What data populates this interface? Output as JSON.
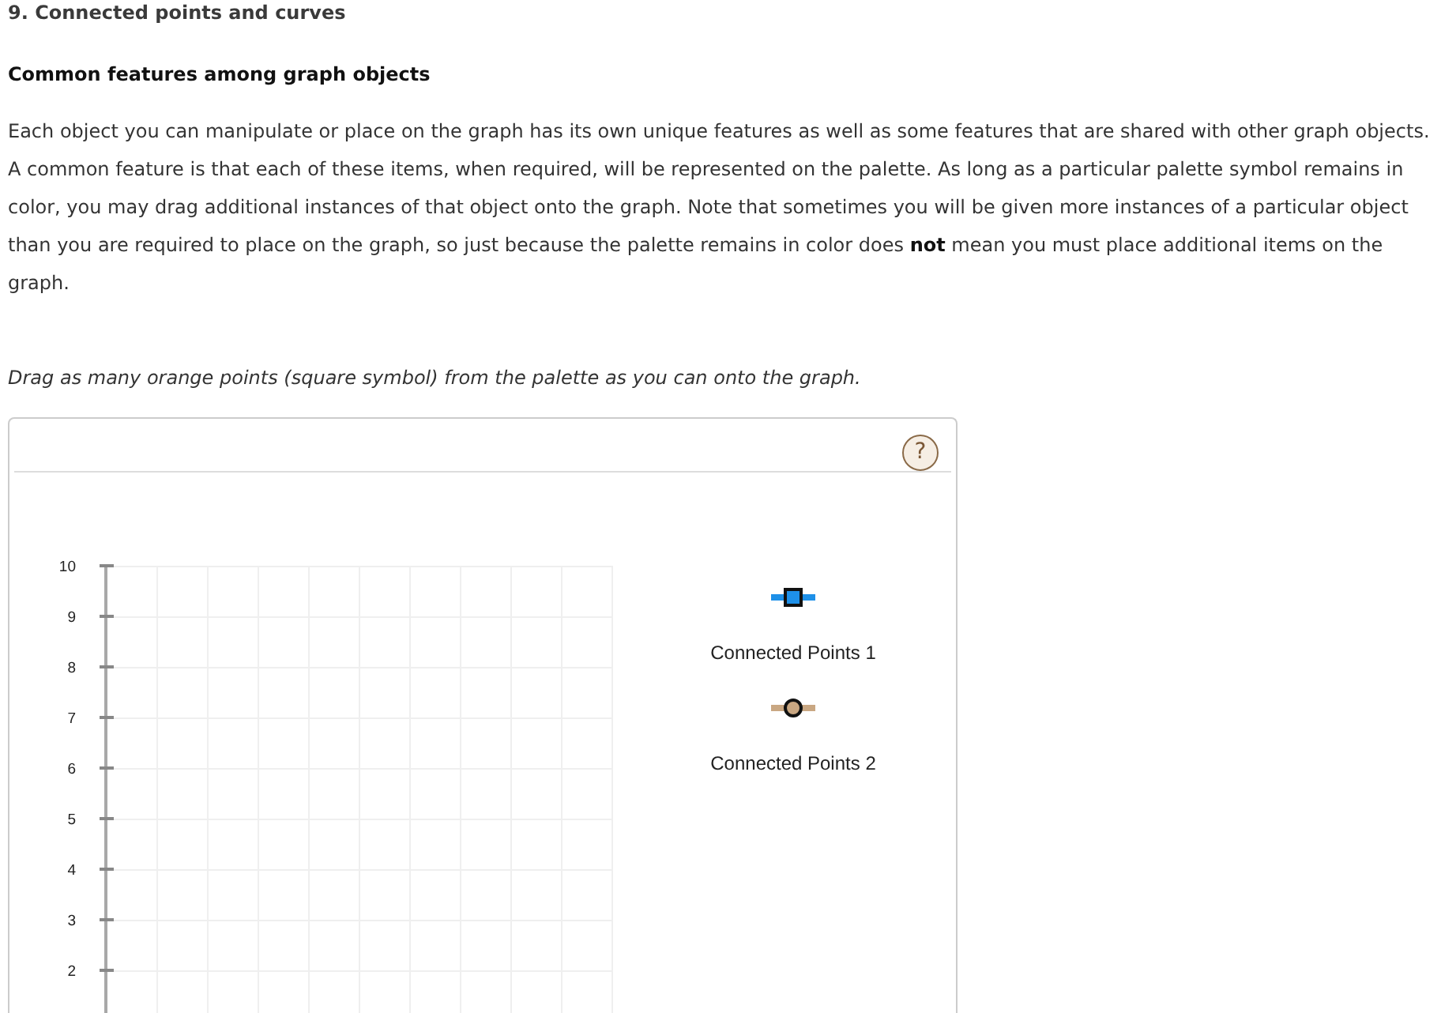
{
  "question": {
    "title": "9. Connected points and curves"
  },
  "section": {
    "heading": "Common features among graph objects",
    "paragraph": "Each object you can manipulate or place on the graph has its own unique features as well as some features that are shared with other graph objects. A common feature is that each of these items, when required, will be represented on the palette. As long as a particular palette symbol remains in color, you may drag additional instances of that object onto the graph. Note that sometimes you will be given more instances of a particular object than you are required to place on the graph, so just because the palette remains in color does **not** mean you must place additional items on the graph."
  },
  "instruction": "Drag as many orange points (square symbol) from the palette as you can onto the graph.",
  "graph_panel": {
    "help_button": {
      "label": "?"
    },
    "graph": {
      "y_tick_labels": [
        "10",
        "9",
        "8",
        "7",
        "6",
        "5",
        "4",
        "3",
        "2"
      ]
    },
    "palette": [
      {
        "kind": "square",
        "color": "#1e90e8",
        "label": "Connected Points 1"
      },
      {
        "kind": "circle",
        "color": "#c9a782",
        "label": "Connected Points 2"
      }
    ]
  }
}
